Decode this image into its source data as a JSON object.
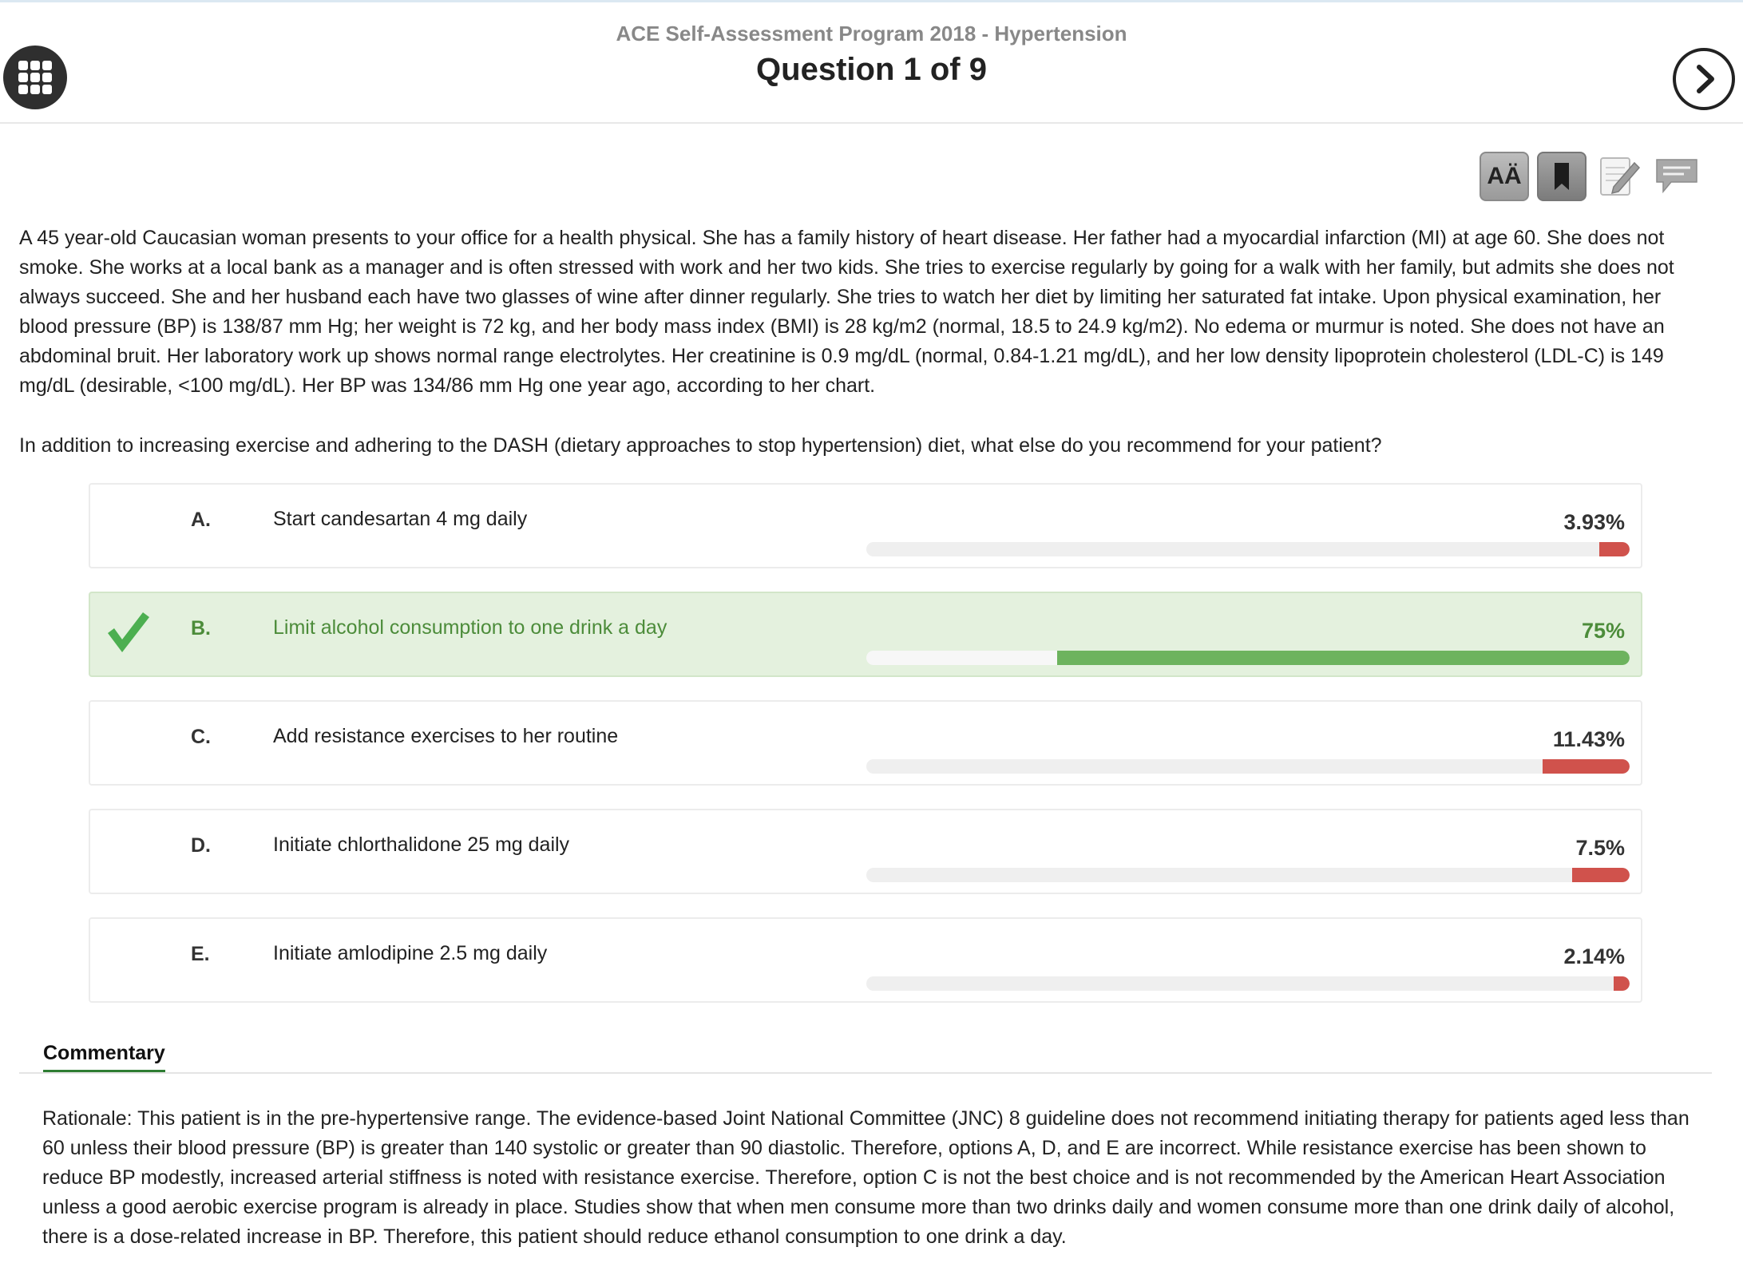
{
  "header": {
    "subtitle": "ACE Self-Assessment Program 2018 - Hypertension",
    "title": "Question 1 of 9",
    "menu_icon": "grid-icon",
    "next_icon": "chevron-right-icon"
  },
  "toolbar": {
    "font_label": "AÄ",
    "tools": [
      "font-size-icon",
      "bookmark-icon",
      "notepad-pencil-icon",
      "comment-icon"
    ]
  },
  "question": {
    "stem": "A 45 year-old Caucasian woman presents to your office for a health physical. She has a family history of heart disease. Her father had a myocardial infarction (MI) at age 60. She does not smoke. She works at a local bank as a manager and is often stressed with work and her two kids. She tries to exercise regularly by going for a walk with her family, but admits she does not always succeed. She and her husband each have two glasses of wine after dinner regularly. She tries to watch her diet by limiting her saturated fat intake. Upon physical examination, her blood pressure (BP) is 138/87 mm Hg; her weight is 72 kg, and her body mass index (BMI) is 28 kg/m2 (normal, 18.5 to 24.9 kg/m2). No edema or murmur is noted. She does not have an abdominal bruit. Her laboratory work up shows normal range electrolytes. Her creatinine is 0.9 mg/dL (normal, 0.84-1.21 mg/dL), and her low density lipoprotein cholesterol (LDL-C) is 149 mg/dL (desirable, <100 mg/dL). Her BP was 134/86 mm Hg one year ago, according to her chart.",
    "prompt": "In addition to increasing exercise and adhering to the DASH (dietary approaches to stop hypertension) diet, what else do you recommend for your patient?"
  },
  "answers": [
    {
      "letter": "A.",
      "text": "Start candesartan 4 mg daily",
      "percent_label": "3.93%",
      "percent": 3.93,
      "correct": false
    },
    {
      "letter": "B.",
      "text": "Limit alcohol consumption to one drink a day",
      "percent_label": "75%",
      "percent": 75,
      "correct": true
    },
    {
      "letter": "C.",
      "text": "Add resistance exercises to her routine",
      "percent_label": "11.43%",
      "percent": 11.43,
      "correct": false
    },
    {
      "letter": "D.",
      "text": "Initiate chlorthalidone 25 mg daily",
      "percent_label": "7.5%",
      "percent": 7.5,
      "correct": false
    },
    {
      "letter": "E.",
      "text": "Initiate amlodipine 2.5 mg daily",
      "percent_label": "2.14%",
      "percent": 2.14,
      "correct": false
    }
  ],
  "colors": {
    "correct": "#6db35e",
    "incorrect": "#d0524c",
    "correct_bg": "#e4f1de",
    "tab_underline": "#2e7d32"
  },
  "commentary": {
    "tab_label": "Commentary",
    "text": "Rationale: This patient is in the pre-hypertensive range. The evidence-based Joint National Committee (JNC) 8 guideline does not recommend initiating therapy for patients aged less than 60 unless their blood pressure (BP) is greater than 140 systolic or greater than 90 diastolic. Therefore, options A, D, and E are incorrect. While resistance exercise has been shown to reduce BP modestly, increased arterial stiffness is noted with resistance exercise. Therefore, option C is not the best choice and is not recommended by the American Heart Association unless a good aerobic exercise program is already in place. Studies show that when men consume more than two drinks daily and women consume more than one drink daily of alcohol, there is a dose-related increase in BP. Therefore, this patient should reduce ethanol consumption to one drink a day."
  }
}
